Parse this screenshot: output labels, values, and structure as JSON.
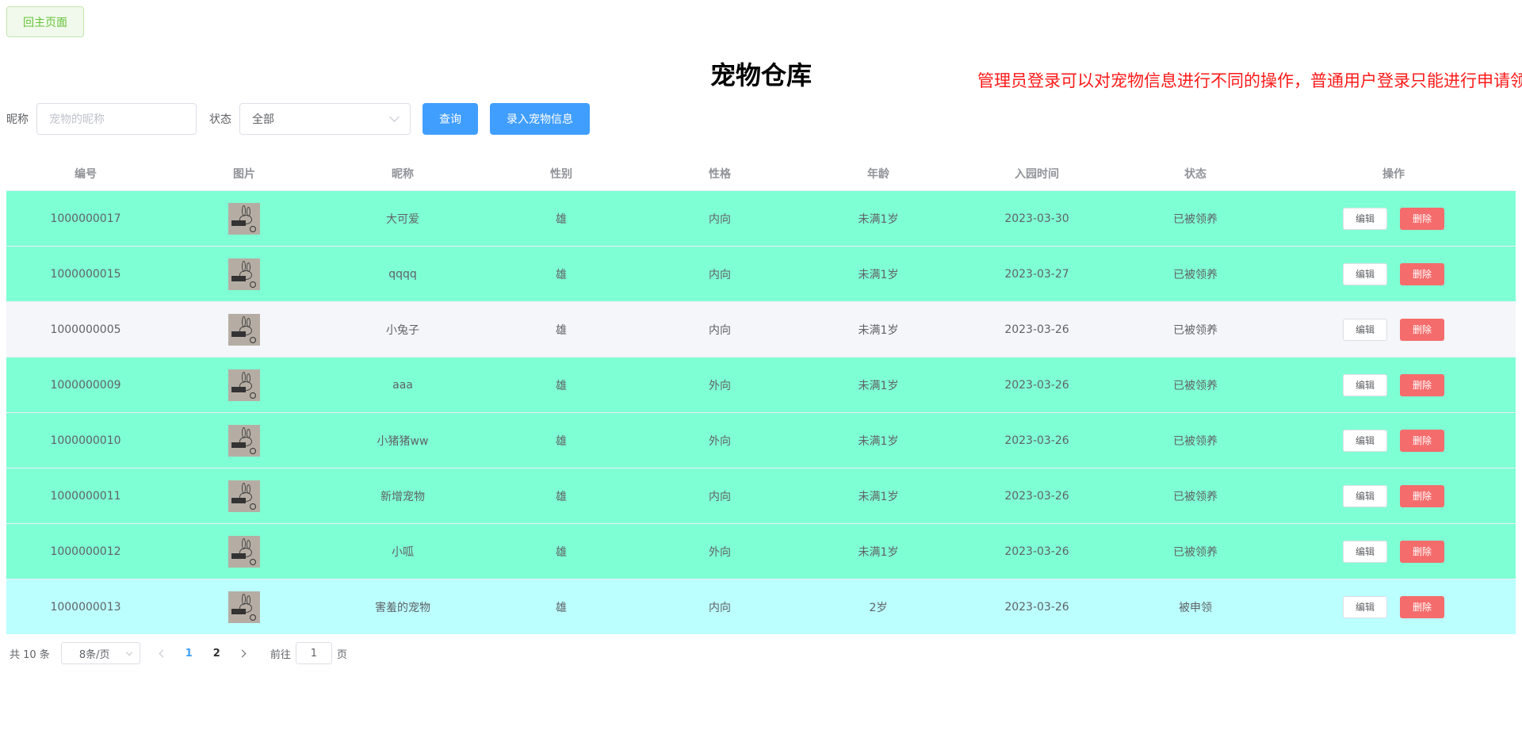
{
  "home_button": "回主页面",
  "title": "宠物仓库",
  "notice": "管理员登录可以对宠物信息进行不同的操作，普通用户登录只能进行申请领",
  "filters": {
    "nickname_label": "昵称",
    "nickname_placeholder": "宠物的昵称",
    "status_label": "状态",
    "status_value": "全部",
    "query_button": "查询",
    "add_button": "录入宠物信息"
  },
  "table": {
    "headers": [
      "编号",
      "图片",
      "昵称",
      "性别",
      "性格",
      "年龄",
      "入园时间",
      "状态",
      "操作"
    ],
    "edit_label": "编辑",
    "delete_label": "删除",
    "rows": [
      {
        "id": "1000000017",
        "name": "大可爱",
        "gender": "雄",
        "personality": "内向",
        "age": "未满1岁",
        "date": "2023-03-30",
        "status": "已被领养",
        "bg": "#7fffd4"
      },
      {
        "id": "1000000015",
        "name": "qqqq",
        "gender": "雄",
        "personality": "内向",
        "age": "未满1岁",
        "date": "2023-03-27",
        "status": "已被领养",
        "bg": "#7fffd4"
      },
      {
        "id": "1000000005",
        "name": "小兔子",
        "gender": "雄",
        "personality": "内向",
        "age": "未满1岁",
        "date": "2023-03-26",
        "status": "已被领养",
        "bg": "#f4f6f9"
      },
      {
        "id": "1000000009",
        "name": "aaa",
        "gender": "雄",
        "personality": "外向",
        "age": "未满1岁",
        "date": "2023-03-26",
        "status": "已被领养",
        "bg": "#7fffd4"
      },
      {
        "id": "1000000010",
        "name": "小猪猪ww",
        "gender": "雄",
        "personality": "外向",
        "age": "未满1岁",
        "date": "2023-03-26",
        "status": "已被领养",
        "bg": "#7fffd4"
      },
      {
        "id": "1000000011",
        "name": "新增宠物",
        "gender": "雄",
        "personality": "内向",
        "age": "未满1岁",
        "date": "2023-03-26",
        "status": "已被领养",
        "bg": "#7fffd4"
      },
      {
        "id": "1000000012",
        "name": "小呱",
        "gender": "雄",
        "personality": "外向",
        "age": "未满1岁",
        "date": "2023-03-26",
        "status": "已被领养",
        "bg": "#7fffd4"
      },
      {
        "id": "1000000013",
        "name": "害羞的宠物",
        "gender": "雄",
        "personality": "内向",
        "age": "2岁",
        "date": "2023-03-26",
        "status": "被申领",
        "bg": "#bbffff"
      }
    ]
  },
  "pagination": {
    "total": "共 10 条",
    "page_size": "8条/页",
    "pages": [
      "1",
      "2"
    ],
    "current": "1",
    "goto_label": "前往",
    "goto_value": "1",
    "goto_suffix": "页"
  }
}
